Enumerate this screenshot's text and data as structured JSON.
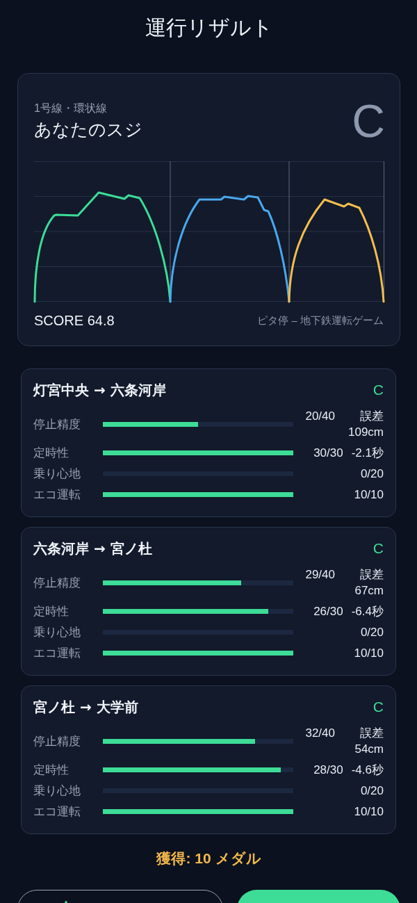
{
  "title": "運行リザルト",
  "summary": {
    "line": "1号線・環状線",
    "heading": "あなたのスジ",
    "grade": "C",
    "score": "SCORE 64.8",
    "credit": "ピタ停 – 地下鉄運転ゲーム"
  },
  "segments": [
    {
      "route": "灯宮中央 → 六条河岸",
      "grade": "C",
      "metrics": [
        {
          "label": "停止精度",
          "level": 0.5,
          "score": "20/40",
          "detail": "誤差 109cm"
        },
        {
          "label": "定時性",
          "level": 1,
          "score": "30/30",
          "detail": "-2.1秒"
        },
        {
          "label": "乗り心地",
          "level": 0,
          "score": "0/20"
        },
        {
          "label": "エコ運転",
          "level": 1,
          "score": "10/10"
        }
      ]
    },
    {
      "route": "六条河岸 → 宮ノ杜",
      "grade": "C",
      "metrics": [
        {
          "label": "停止精度",
          "level": 0.725,
          "score": "29/40",
          "detail": "誤差 67cm"
        },
        {
          "label": "定時性",
          "level": 0.867,
          "score": "26/30",
          "detail": "-6.4秒"
        },
        {
          "label": "乗り心地",
          "level": 0,
          "score": "0/20"
        },
        {
          "label": "エコ運転",
          "level": 1,
          "score": "10/10"
        }
      ]
    },
    {
      "route": "宮ノ杜 → 大学前",
      "grade": "C",
      "metrics": [
        {
          "label": "停止精度",
          "level": 0.8,
          "score": "32/40",
          "detail": "誤差 54cm"
        },
        {
          "label": "定時性",
          "level": 0.933,
          "score": "28/30",
          "detail": "-4.6秒"
        },
        {
          "label": "乗り心地",
          "level": 0,
          "score": "0/20"
        },
        {
          "label": "エコ運転",
          "level": 1,
          "score": "10/10"
        }
      ]
    }
  ],
  "reward": "獲得: 10 メダル",
  "buttons": [
    {
      "kind": "outline"
    },
    {
      "kind": "primary"
    }
  ]
}
